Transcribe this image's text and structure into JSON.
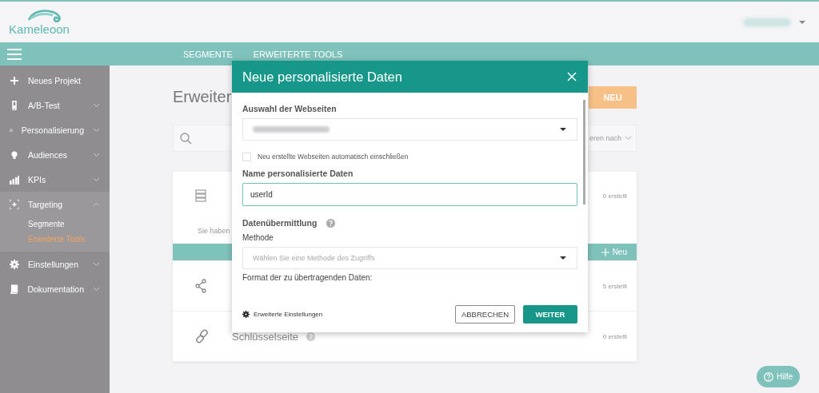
{
  "header": {
    "logo": "Kameleoon"
  },
  "nav": {
    "tabs": [
      {
        "label": "SEGMENTE"
      },
      {
        "label": "ERWEITERTE TOOLS"
      }
    ]
  },
  "sidebar": {
    "items": [
      {
        "label": "Neues Projekt",
        "chevron": false
      },
      {
        "label": "A/B-Test",
        "expanded": false,
        "chevron": true
      },
      {
        "label": "Personalisierung",
        "expanded": false,
        "chevron": true
      },
      {
        "label": "Audiences",
        "expanded": false,
        "chevron": true
      },
      {
        "label": "KPIs",
        "expanded": false,
        "chevron": true
      },
      {
        "label": "Targeting",
        "expanded": true,
        "chevron": true,
        "children": [
          {
            "label": "Segmente",
            "selected": false
          },
          {
            "label": "Erweiterte Tools",
            "selected": true
          }
        ]
      },
      {
        "label": "Einstellungen",
        "expanded": false,
        "chevron": true
      },
      {
        "label": "Dokumentation",
        "expanded": false,
        "chevron": true
      }
    ]
  },
  "main": {
    "title": "Erweiter",
    "new_button": "NEU",
    "sort": "eren nach",
    "cards": [
      {
        "count": "0 erstellt",
        "note": "Sie haben",
        "action": "Neu"
      },
      {
        "count": "5 erstellt"
      },
      {
        "label": "Schlüsselseite",
        "help": true,
        "count": "0 erstellt"
      }
    ]
  },
  "modal": {
    "title": "Neue personalisierte Daten",
    "fields": [
      {
        "kind": "label",
        "text": "Auswahl der Webseiten"
      },
      {
        "kind": "select",
        "redacted": true
      },
      {
        "kind": "checkbox",
        "text": "Neu erstellte Webseiten automatisch einschließen",
        "checked": false
      },
      {
        "kind": "label",
        "text": "Name personalisierte Daten"
      },
      {
        "kind": "input",
        "value": "userId"
      },
      {
        "kind": "label",
        "text": "Datenübermittlung",
        "help": true
      },
      {
        "kind": "sublabel",
        "text": "Methode"
      },
      {
        "kind": "select",
        "placeholder": "Wählen Sie eine Methode des Zugriffs"
      },
      {
        "kind": "sublabel",
        "text": "Format der zu übertragenden Daten:"
      }
    ],
    "advanced": "Erweiterte Einstellungen",
    "cancel": "ABBRECHEN",
    "next": "WEITER"
  },
  "help_button": "Hilfe"
}
